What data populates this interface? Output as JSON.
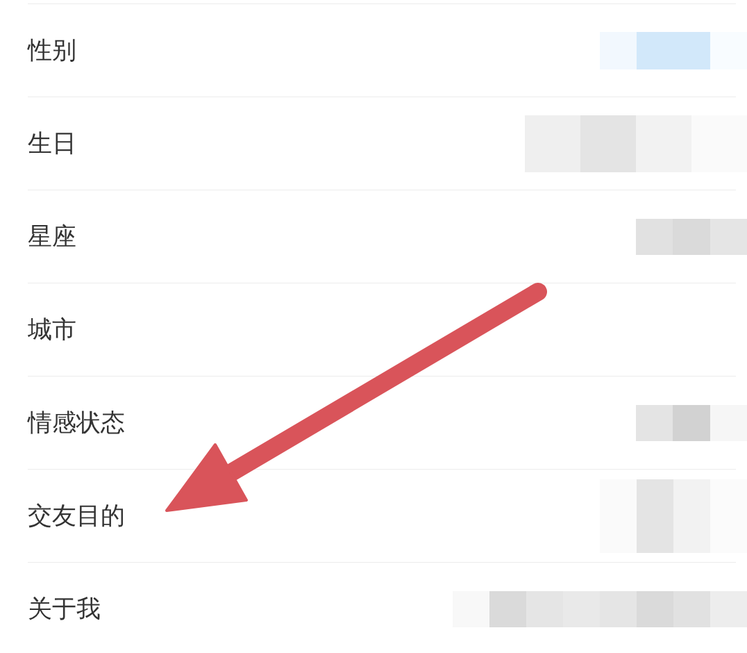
{
  "rows": [
    {
      "label": "性别",
      "masked": true,
      "color": "#d2e8fa"
    },
    {
      "label": "生日",
      "masked": true,
      "color": "#e4e4e4"
    },
    {
      "label": "星座",
      "masked": true,
      "color": "#dadada"
    },
    {
      "label": "城市",
      "masked": false
    },
    {
      "label": "情感状态",
      "masked": true,
      "color": "#d2d2d2"
    },
    {
      "label": "交友目的",
      "masked": true,
      "color": "#e4e4e4"
    },
    {
      "label": "关于我",
      "masked": true,
      "color": "#dadada"
    }
  ],
  "annotation": {
    "kind": "arrow"
  }
}
